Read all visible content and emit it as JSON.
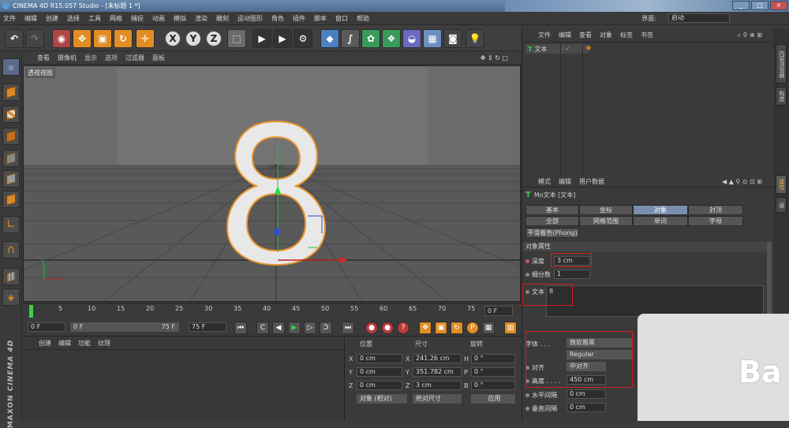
{
  "window": {
    "title": "CINEMA 4D R15.057 Studio - [未标题 1 *]"
  },
  "menubar": {
    "items": [
      "文件",
      "编辑",
      "创建",
      "选择",
      "工具",
      "网格",
      "捕捉",
      "动画",
      "模拟",
      "渲染",
      "雕刻",
      "运动图形",
      "角色",
      "插件",
      "脚本",
      "窗口",
      "帮助"
    ],
    "layout_label": "界面:",
    "layout_value": "启动"
  },
  "toolbar": {
    "axis_x": "X",
    "axis_y": "Y",
    "axis_z": "Z"
  },
  "viewport": {
    "menu": [
      "查看",
      "摄像机",
      "显示",
      "选项",
      "过滤器",
      "面板"
    ],
    "label": "透视视图",
    "object_text": "8"
  },
  "timeline": {
    "ticks": [
      "0",
      "5",
      "10",
      "15",
      "20",
      "25",
      "30",
      "35",
      "40",
      "45",
      "50",
      "55",
      "60",
      "65",
      "70",
      "75"
    ],
    "current_frame": "0 F"
  },
  "transport": {
    "start": "0 F",
    "slider_start": "0 F",
    "slider_end": "75 F",
    "end": "75 F"
  },
  "material": {
    "menu": [
      "创建",
      "编辑",
      "功能",
      "纹理"
    ],
    "logo_line1": "MAXON",
    "logo_line2": "CINEMA 4D"
  },
  "coords": {
    "headers": {
      "position": "位置",
      "size": "尺寸",
      "rotation": "旋转"
    },
    "rows": [
      {
        "axis": "X",
        "pos": "0 cm",
        "size_axis": "X",
        "size": "241.26 cm",
        "rot_axis": "H",
        "rot": "0 °"
      },
      {
        "axis": "Y",
        "pos": "0 cm",
        "size_axis": "Y",
        "size": "351.782 cm",
        "rot_axis": "P",
        "rot": "0 °"
      },
      {
        "axis": "Z",
        "pos": "0 cm",
        "size_axis": "Z",
        "size": "3 cm",
        "rot_axis": "B",
        "rot": "0 °"
      }
    ],
    "mode": "对象 (相对)",
    "size_mode": "绝对尺寸",
    "apply": "应用"
  },
  "object_manager": {
    "menu": [
      "文件",
      "编辑",
      "查看",
      "对象",
      "标签",
      "书签"
    ],
    "objects": [
      {
        "name": "文本"
      }
    ]
  },
  "attributes": {
    "menu": [
      "模式",
      "编辑",
      "用户数据"
    ],
    "object_title": "Mo文本 [文本]",
    "tabs_row1": [
      "基本",
      "坐标",
      "对象",
      "封顶"
    ],
    "tabs_row2": [
      "全部",
      "网格范围",
      "单词",
      "字母"
    ],
    "tab_phong": "平滑着色(Phong)",
    "section": "对象属性",
    "depth_label": "深度",
    "depth_value": "3 cm",
    "subdiv_label": "细分数",
    "subdiv_value": "1",
    "text_label": "文本",
    "text_value": "8",
    "font_label": "字体",
    "font_value": "微软雅黑",
    "font_style": "Regular",
    "align_label": "对齐",
    "align_value": "中对齐",
    "height_label": "高度",
    "height_value": "450 cm",
    "hspace_label": "水平间隔",
    "hspace_value": "0 cm",
    "vspace_label": "垂直间隔",
    "vspace_value": "0 cm"
  },
  "right_tabs": [
    "内容浏览器",
    "构造",
    "属性",
    "层"
  ],
  "watermark": "Ba"
}
